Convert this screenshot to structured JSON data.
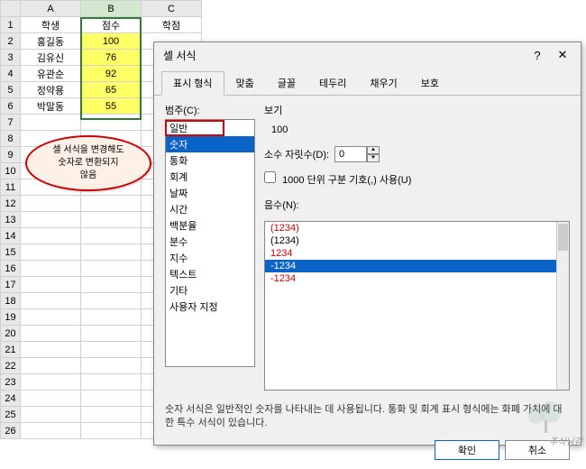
{
  "sheet": {
    "cols": [
      "A",
      "B",
      "C"
    ],
    "headers": {
      "A": "학생",
      "B": "점수",
      "C": "학점"
    },
    "rows": [
      {
        "n": 1
      },
      {
        "n": 2,
        "A": "홍길동",
        "B": "100"
      },
      {
        "n": 3,
        "A": "김유신",
        "B": "76"
      },
      {
        "n": 4,
        "A": "유관순",
        "B": "92"
      },
      {
        "n": 5,
        "A": "정약용",
        "B": "65"
      },
      {
        "n": 6,
        "A": "박말동",
        "B": "55"
      }
    ],
    "maxRow": 26
  },
  "bubble": {
    "line1": "셀 서식을 변경해도",
    "line2": "숫자로 변환되지",
    "line3": "않음"
  },
  "dialog": {
    "title": "셀 서식",
    "help": "?",
    "close": "✕",
    "tabs": [
      "표시 형식",
      "맞춤",
      "글꼴",
      "테두리",
      "채우기",
      "보호"
    ],
    "activeTab": 0,
    "categoryLabel": "범주(C):",
    "categories": [
      "일반",
      "숫자",
      "통화",
      "회계",
      "날짜",
      "시간",
      "백분율",
      "분수",
      "지수",
      "텍스트",
      "기타",
      "사용자 지정"
    ],
    "selectedCategory": 1,
    "previewLabel": "보기",
    "previewValue": "100",
    "decimalLabel": "소수 자릿수(D):",
    "decimalValue": "0",
    "thousandsLabel": "1000 단위 구분 기호(,) 사용(U)",
    "negLabel": "음수(N):",
    "negFormats": [
      {
        "text": "(1234)",
        "cls": "red"
      },
      {
        "text": "(1234)",
        "cls": ""
      },
      {
        "text": "1234",
        "cls": "red"
      },
      {
        "text": "-1234",
        "cls": "sel"
      },
      {
        "text": "-1234",
        "cls": "red"
      }
    ],
    "description": "숫자 서식은 일반적인 숫자를 나타내는 데 사용됩니다. 통화 및 회계 표시 형식에는 화폐 가치에 대한 특수 서식이 있습니다.",
    "ok": "확인",
    "cancel": "취소"
  },
  "watermark": "주식님감"
}
